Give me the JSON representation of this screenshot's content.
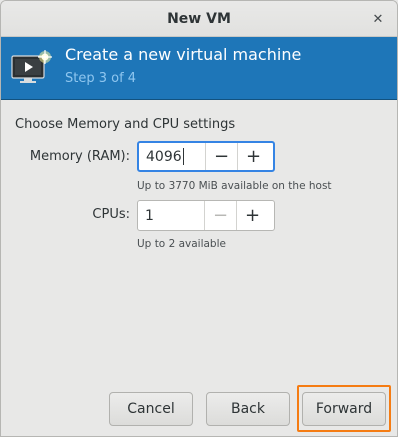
{
  "window": {
    "title": "New VM",
    "close_glyph": "✕"
  },
  "banner": {
    "icon": "virtual-machine-icon",
    "heading": "Create a new virtual machine",
    "step": "Step 3 of 4",
    "colors": {
      "background": "#1e76b8",
      "step_text": "#8fc6ef"
    }
  },
  "section": {
    "title": "Choose Memory and CPU settings"
  },
  "memory": {
    "label": "Memory (RAM):",
    "value": "4096",
    "decrement": "−",
    "increment": "+",
    "hint": "Up to 3770 MiB available on the host"
  },
  "cpus": {
    "label": "CPUs:",
    "value": "1",
    "decrement": "−",
    "increment": "+",
    "hint": "Up to 2 available"
  },
  "buttons": {
    "cancel": "Cancel",
    "back": "Back",
    "forward": "Forward"
  },
  "highlight_color": "#f57c13",
  "focus_color": "#3584e4"
}
